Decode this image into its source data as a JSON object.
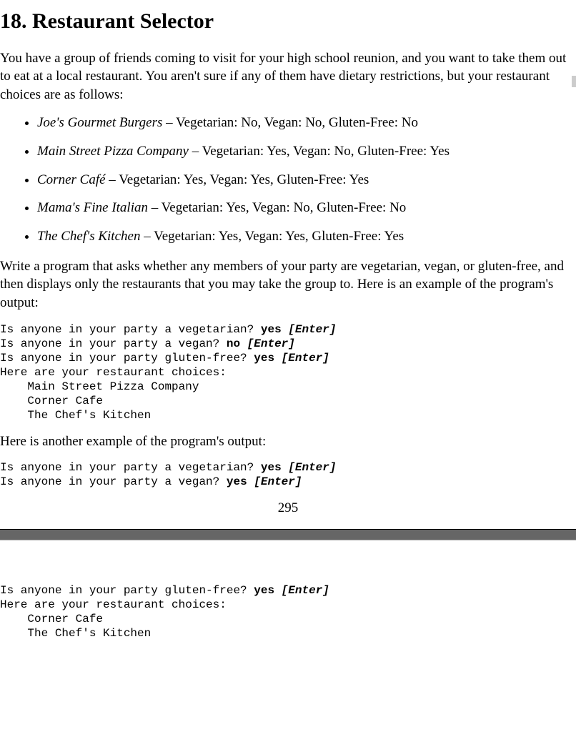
{
  "title": "18. Restaurant Selector",
  "intro": "You have a group of friends coming to visit for your high school reunion, and you want to take them out to eat at a local restaurant. You aren't sure if any of them have dietary restrictions, but your restaurant choices are as follows:",
  "restaurants": [
    {
      "name": "Joe's Gourmet Burgers",
      "details": " – Vegetarian: No, Vegan: No, Gluten-Free: No"
    },
    {
      "name": "Main Street Pizza Company",
      "details": " – Vegetarian: Yes, Vegan: No, Gluten-Free: Yes"
    },
    {
      "name": "Corner Café",
      "details": " – Vegetarian: Yes, Vegan: Yes, Gluten-Free: Yes"
    },
    {
      "name": "Mama's Fine Italian",
      "details": " – Vegetarian: Yes, Vegan: No, Gluten-Free: No"
    },
    {
      "name": "The Chef's Kitchen",
      "details": " – Vegetarian: Yes, Vegan: Yes, Gluten-Free: Yes"
    }
  ],
  "instructions": "Write a program that asks whether any members of your party are vegetarian, vegan, or gluten-free, and then displays only the restaurants that you may take the group to. Here is an example of the program's output:",
  "example1": {
    "lines": [
      {
        "prompt": "Is anyone in your party a vegetarian? ",
        "input": "yes",
        "enter": " [Enter]"
      },
      {
        "prompt": "Is anyone in your party a vegan? ",
        "input": "no",
        "enter": " [Enter]"
      },
      {
        "prompt": "Is anyone in your party gluten-free? ",
        "input": "yes",
        "enter": " [Enter]"
      }
    ],
    "result_header": "Here are your restaurant choices:",
    "results": [
      "    Main Street Pizza Company",
      "    Corner Cafe",
      "    The Chef's Kitchen"
    ]
  },
  "between": "Here is another example of the program's output:",
  "example2a": {
    "lines": [
      {
        "prompt": "Is anyone in your party a vegetarian? ",
        "input": "yes",
        "enter": " [Enter]"
      },
      {
        "prompt": "Is anyone in your party a vegan? ",
        "input": "yes",
        "enter": " [Enter]"
      }
    ]
  },
  "page_number": "295",
  "example2b": {
    "lines": [
      {
        "prompt": "Is anyone in your party gluten-free? ",
        "input": "yes",
        "enter": " [Enter]"
      }
    ],
    "result_header": "Here are your restaurant choices:",
    "results": [
      "    Corner Cafe",
      "    The Chef's Kitchen"
    ]
  }
}
